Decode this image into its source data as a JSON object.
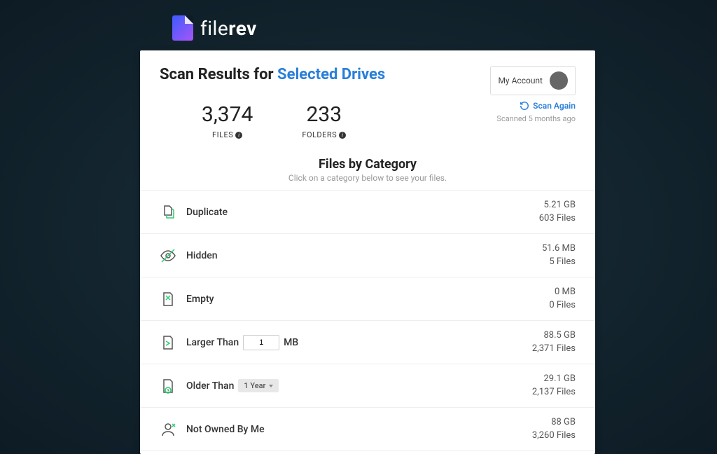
{
  "brand": {
    "name_a": "file",
    "name_b": "rev"
  },
  "header": {
    "title_prefix": "Scan Results for ",
    "title_link": "Selected Drives",
    "account_label": "My Account",
    "scan_again": "Scan Again",
    "scan_time": "Scanned 5 months ago"
  },
  "stats": {
    "files": {
      "value": "3,374",
      "label": "FILES"
    },
    "folders": {
      "value": "233",
      "label": "FOLDERS"
    }
  },
  "section": {
    "title": "Files by Category",
    "subtitle": "Click on a category below to see your files."
  },
  "categories": [
    {
      "label": "Duplicate",
      "size": "5.21 GB",
      "count": "603 Files"
    },
    {
      "label": "Hidden",
      "size": "51.6 MB",
      "count": "5 Files"
    },
    {
      "label": "Empty",
      "size": "0 MB",
      "count": "0 Files"
    },
    {
      "label": "Larger Than",
      "size": "88.5 GB",
      "count": "2,371 Files",
      "input_value": "1",
      "unit": "MB"
    },
    {
      "label": "Older Than",
      "size": "29.1 GB",
      "count": "2,137 Files",
      "dropdown": "1 Year"
    },
    {
      "label": "Not Owned By Me",
      "size": "88 GB",
      "count": "3,260 Files"
    }
  ]
}
